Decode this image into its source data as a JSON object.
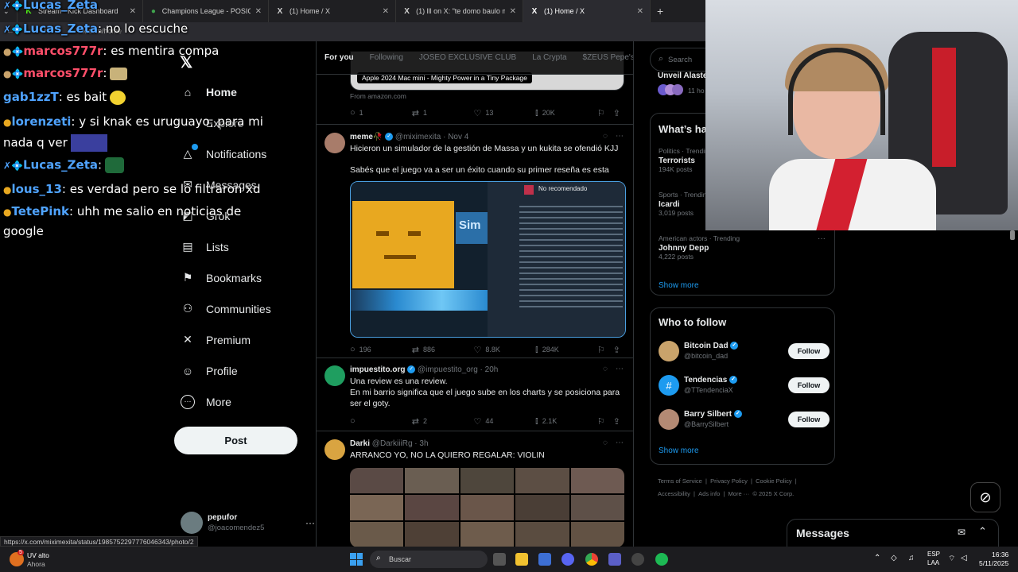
{
  "browser": {
    "tabs": [
      {
        "label": "Stream - Kick Dashboard",
        "icon": "K",
        "icon_color": "#53fc18",
        "active": false
      },
      {
        "label": "Champions League - POSICIONE",
        "icon": "●",
        "icon_color": "#3fa34d",
        "active": false
      },
      {
        "label": "(1) Home / X",
        "icon": "X",
        "icon_color": "#ffffff",
        "active": false
      },
      {
        "label": "(1) lll on X: \"te domo baulo mo",
        "icon": "X",
        "icon_color": "#ffffff",
        "active": false
      },
      {
        "label": "(1) Home / X",
        "icon": "X",
        "icon_color": "#ffffff",
        "active": true
      }
    ],
    "new_tab": "+",
    "address": "x.com/home",
    "status_url": "https://x.com/miximexita/status/1985752297776046343/photo/2"
  },
  "nav": {
    "items": [
      {
        "label": "Home",
        "icon": "home-icon",
        "glyph": "⌂",
        "bold": true
      },
      {
        "label": "Explore",
        "icon": "search-icon",
        "glyph": "⌕",
        "bold": false
      },
      {
        "label": "Notifications",
        "icon": "bell-icon",
        "glyph": "🔔",
        "bold": false
      },
      {
        "label": "Messages",
        "icon": "mail-icon",
        "glyph": "✉",
        "bold": false
      },
      {
        "label": "Grok",
        "icon": "grok-icon",
        "glyph": "◩",
        "bold": false
      },
      {
        "label": "Lists",
        "icon": "list-icon",
        "glyph": "▤",
        "bold": false
      },
      {
        "label": "Bookmarks",
        "icon": "bookmark-icon",
        "glyph": "⚑",
        "bold": false
      },
      {
        "label": "Communities",
        "icon": "people-icon",
        "glyph": "⚇",
        "bold": false
      },
      {
        "label": "Premium",
        "icon": "x-logo-icon",
        "glyph": "✕",
        "bold": false
      },
      {
        "label": "Profile",
        "icon": "person-icon",
        "glyph": "☺",
        "bold": false
      },
      {
        "label": "More",
        "icon": "more-circle-icon",
        "glyph": "⋯",
        "bold": false
      }
    ],
    "post_label": "Post",
    "account_name": "pepufor",
    "account_handle": "@joacomendez5",
    "account_more": "···"
  },
  "feed": {
    "tabs": [
      "For you",
      "Following",
      "JOSEO EXCLUSIVE CLUB",
      "La Crypta",
      "$ZEUS Pepe's"
    ],
    "ad": {
      "card_title": "Apple 2024 Mac mini - Mighty Power in a Tiny Package",
      "source": "From amazon.com",
      "replies": "1",
      "reposts": "1",
      "likes": "13",
      "views": "20K"
    },
    "tweets": [
      {
        "name": "meme🥀",
        "handle": "@miximexita",
        "time": "· Nov 4",
        "text1": "Hicieron un simulador de la gestión de Massa y un kukita se ofendió KJJ",
        "text2": "Sabés que el juego va a ser un éxito cuando su primer reseña es esta",
        "media_review_label": "No recomendado",
        "media_logo": "Sim",
        "replies": "196",
        "reposts": "886",
        "likes": "8.8K",
        "views": "284K"
      },
      {
        "name": "impuestito.org",
        "handle": "@impuestito_org",
        "time": "· 20h",
        "text1": "Una review es una review.",
        "text2": "En mi barrio significa que el juego sube en los charts y se posiciona para ser el goty.",
        "replies": "",
        "reposts": "2",
        "likes": "44",
        "views": "2.1K"
      },
      {
        "name": "Darki",
        "handle": "@DarkiiiRg",
        "time": "· 3h",
        "text1": "ARRANCO YO, NO LA QUIERO REGALAR: VIOLIN"
      }
    ]
  },
  "right": {
    "search_placeholder": "Search",
    "live_label": "Unveil Alaste",
    "live_time": "11 ho",
    "trends_title": "What’s happening",
    "trends": [
      {
        "sub": "Politics · Trending",
        "name": "Terrorists",
        "count": "194K posts"
      },
      {
        "sub": "Sports · Trending",
        "name": "Icardi",
        "count": "3,019 posts"
      },
      {
        "sub": "American actors · Trending",
        "name": "Johnny Depp",
        "count": "4,222 posts"
      }
    ],
    "trend_more": "···",
    "show_more": "Show more",
    "follow_title": "Who to follow",
    "follow": [
      {
        "name": "Bitcoin Dad",
        "handle": "@bitcoin_dad",
        "btn": "Follow",
        "avatar_color": "#c9a36b"
      },
      {
        "name": "Tendencias",
        "handle": "@TTendenciaX",
        "btn": "Follow",
        "avatar_color": "#1d9bf0"
      },
      {
        "name": "Barry Silbert",
        "handle": "@BarrySilbert",
        "btn": "Follow",
        "avatar_color": "#b48a74"
      }
    ],
    "footer": [
      "Terms of Service",
      "|",
      "Privacy Policy",
      "|",
      "Cookie Policy",
      "|",
      "Accessibility",
      "|",
      "Ads info",
      "|",
      "More ···",
      "© 2025 X Corp."
    ],
    "messages_label": "Messages"
  },
  "chat": [
    {
      "user": "Lucas_Zeta",
      "msg": "",
      "color": "#4fa3ff",
      "badges": "✗💠"
    },
    {
      "user": "Lucas_Zeta",
      "msg": ": no lo escuche",
      "color": "#4fa3ff",
      "badges": "✗💠"
    },
    {
      "user": "marcos777r",
      "msg": ": es mentira compa",
      "color": "#ff4f6a",
      "badges": "●💠"
    },
    {
      "user": "marcos777r",
      "msg": ":",
      "color": "#ff4f6a",
      "badges": "●💠"
    },
    {
      "user": "gab1zzT",
      "msg": ": es bait",
      "color": "#4fa3ff",
      "badges": ""
    },
    {
      "user": "lorenzeti",
      "msg": ": y si knak es uruguayo, para mi",
      "color": "#4fa3ff",
      "badges": "●"
    },
    {
      "user": "",
      "msg": "nada q ver",
      "color": "#ffffff",
      "badges": ""
    },
    {
      "user": "Lucas_Zeta",
      "msg": ":",
      "color": "#4fa3ff",
      "badges": "✗💠"
    },
    {
      "user": "lous_13",
      "msg": ": es verdad pero se lo filtraron xd",
      "color": "#4fa3ff",
      "badges": "●"
    },
    {
      "user": "TetePink",
      "msg": ": uhh me salio en noticias de",
      "color": "#4fa3ff",
      "badges": "●"
    },
    {
      "user": "",
      "msg": "google",
      "color": "#ffffff",
      "badges": ""
    }
  ],
  "taskbar": {
    "weather_temp": "UV alto",
    "weather_sub": "Ahora",
    "weather_badge": "5",
    "search_placeholder": "Buscar",
    "lang_top": "ESP",
    "lang_bottom": "LAA",
    "time": "16:36",
    "date": "5/11/2025"
  },
  "colors": {
    "accent": "#1d9bf0",
    "bg": "#000000",
    "border": "#2f3336",
    "muted": "#71767b"
  }
}
